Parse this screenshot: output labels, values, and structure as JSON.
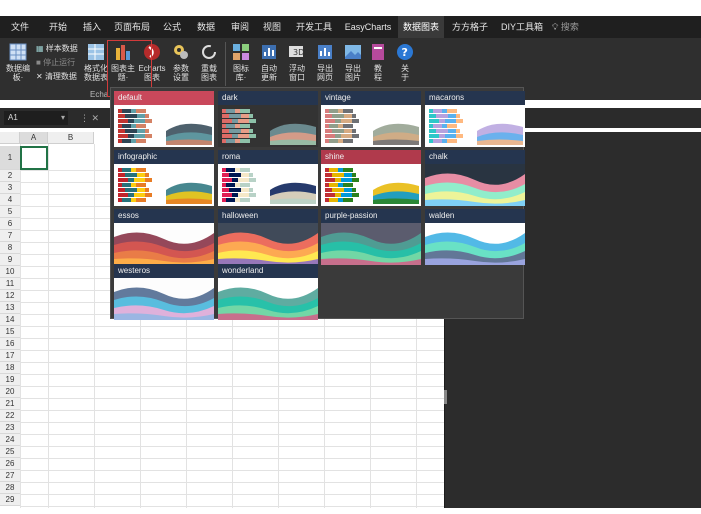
{
  "menu": {
    "tabs": [
      "文件",
      "开始",
      "插入",
      "页面布局",
      "公式",
      "数据",
      "审阅",
      "视图",
      "开发工具",
      "EasyCharts",
      "数据图表",
      "方方格子",
      "DIY工具箱"
    ],
    "active": "数据图表",
    "search": "搜索"
  },
  "ribbon": {
    "buttons": [
      {
        "label": "数据编\n板·",
        "icon": "grid-icon"
      },
      {
        "label": "格式化\n数据表",
        "icon": "table-format-icon"
      },
      {
        "label": "图表主\n题·",
        "icon": "palette-icon"
      },
      {
        "label": "Echarts\n图表",
        "icon": "echarts-icon"
      },
      {
        "label": "参数\n设置",
        "icon": "settings-icon"
      },
      {
        "label": "重载\n图表",
        "icon": "reload-icon"
      },
      {
        "label": "图标\n库·",
        "icon": "icon-library-icon"
      },
      {
        "label": "自动\n更新",
        "icon": "auto-update-icon"
      },
      {
        "label": "浮动\n窗口",
        "icon": "float-window-icon"
      },
      {
        "label": "导出\n网页",
        "icon": "export-web-icon"
      },
      {
        "label": "导出\n图片",
        "icon": "export-image-icon"
      },
      {
        "label": "教\n程",
        "icon": "tutorial-icon"
      },
      {
        "label": "关\n于",
        "icon": "about-icon"
      }
    ],
    "small_buttons": [
      "样本数据",
      "停止运行",
      "清理数据"
    ],
    "group_name": "Echa"
  },
  "formula": {
    "namebox": "A1"
  },
  "columns": [
    "A",
    "B"
  ],
  "rows": [
    "1",
    "2",
    "3",
    "4",
    "5",
    "6",
    "7",
    "8",
    "9",
    "10",
    "11",
    "12",
    "13",
    "14",
    "15",
    "16",
    "17",
    "18",
    "19",
    "20",
    "21",
    "22",
    "23",
    "24",
    "25",
    "26",
    "27",
    "28",
    "29"
  ],
  "themes": [
    {
      "name": "default",
      "style": "bars",
      "selected": true
    },
    {
      "name": "dark",
      "style": "bars-dark"
    },
    {
      "name": "vintage",
      "style": "bars"
    },
    {
      "name": "macarons",
      "style": "bars"
    },
    {
      "name": "infographic",
      "style": "bars"
    },
    {
      "name": "roma",
      "style": "bars"
    },
    {
      "name": "shine",
      "style": "bars",
      "selected": true
    },
    {
      "name": "chalk",
      "style": "area"
    },
    {
      "name": "essos",
      "style": "area"
    },
    {
      "name": "halloween",
      "style": "area"
    },
    {
      "name": "purple-passion",
      "style": "area"
    },
    {
      "name": "walden",
      "style": "area"
    },
    {
      "name": "westeros",
      "style": "area"
    },
    {
      "name": "wonderland",
      "style": "area"
    }
  ],
  "colors": {
    "menubar": "#1f1f1f",
    "ribbon": "#2f2f2f",
    "accent_red": "#d23b3b",
    "label_bg": "#25354f"
  }
}
